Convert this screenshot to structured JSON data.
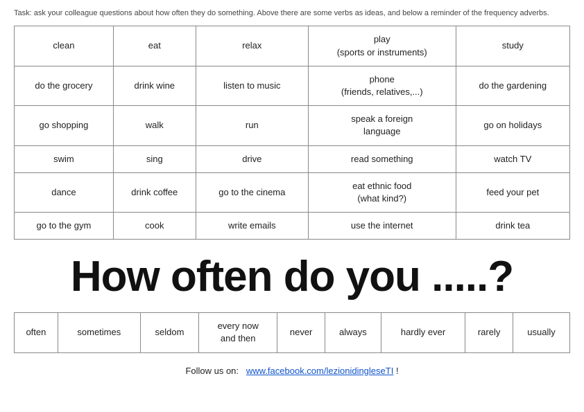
{
  "task": {
    "text": "Task: ask your colleague questions about how often they do something. Above there are some verbs as ideas, and below a reminder of the frequency adverbs."
  },
  "verbs_table": {
    "rows": [
      [
        "clean",
        "eat",
        "relax",
        "play\n(sports or instruments)",
        "study"
      ],
      [
        "do the grocery",
        "drink wine",
        "listen to music",
        "phone\n(friends, relatives,...)",
        "do the gardening"
      ],
      [
        "go shopping",
        "walk",
        "run",
        "speak a foreign\nlanguage",
        "go on holidays"
      ],
      [
        "swim",
        "sing",
        "drive",
        "read something",
        "watch TV"
      ],
      [
        "dance",
        "drink coffee",
        "go to the cinema",
        "eat ethnic food\n(what kind?)",
        "feed your pet"
      ],
      [
        "go to the gym",
        "cook",
        "write emails",
        "use the internet",
        "drink tea"
      ]
    ]
  },
  "big_question": "How often do you .....?",
  "adverbs": {
    "items": [
      "often",
      "sometimes",
      "seldom",
      "every now\nand then",
      "never",
      "always",
      "hardly ever",
      "rarely",
      "usually"
    ]
  },
  "follow_us": {
    "label": "Follow us on:",
    "link_text": "www.facebook.com/lezionidingleseTI",
    "link_href": "https://www.facebook.com/lezionidingleseTI",
    "suffix": " !"
  }
}
